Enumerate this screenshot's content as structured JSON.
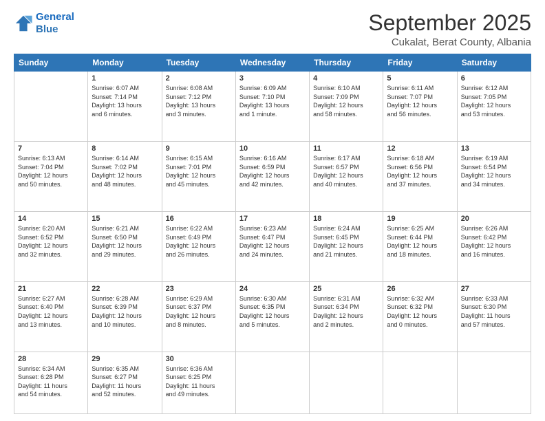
{
  "header": {
    "logo_line1": "General",
    "logo_line2": "Blue",
    "month": "September 2025",
    "location": "Cukalat, Berat County, Albania"
  },
  "weekdays": [
    "Sunday",
    "Monday",
    "Tuesday",
    "Wednesday",
    "Thursday",
    "Friday",
    "Saturday"
  ],
  "weeks": [
    [
      {
        "day": "",
        "info": ""
      },
      {
        "day": "1",
        "info": "Sunrise: 6:07 AM\nSunset: 7:14 PM\nDaylight: 13 hours\nand 6 minutes."
      },
      {
        "day": "2",
        "info": "Sunrise: 6:08 AM\nSunset: 7:12 PM\nDaylight: 13 hours\nand 3 minutes."
      },
      {
        "day": "3",
        "info": "Sunrise: 6:09 AM\nSunset: 7:10 PM\nDaylight: 13 hours\nand 1 minute."
      },
      {
        "day": "4",
        "info": "Sunrise: 6:10 AM\nSunset: 7:09 PM\nDaylight: 12 hours\nand 58 minutes."
      },
      {
        "day": "5",
        "info": "Sunrise: 6:11 AM\nSunset: 7:07 PM\nDaylight: 12 hours\nand 56 minutes."
      },
      {
        "day": "6",
        "info": "Sunrise: 6:12 AM\nSunset: 7:05 PM\nDaylight: 12 hours\nand 53 minutes."
      }
    ],
    [
      {
        "day": "7",
        "info": "Sunrise: 6:13 AM\nSunset: 7:04 PM\nDaylight: 12 hours\nand 50 minutes."
      },
      {
        "day": "8",
        "info": "Sunrise: 6:14 AM\nSunset: 7:02 PM\nDaylight: 12 hours\nand 48 minutes."
      },
      {
        "day": "9",
        "info": "Sunrise: 6:15 AM\nSunset: 7:01 PM\nDaylight: 12 hours\nand 45 minutes."
      },
      {
        "day": "10",
        "info": "Sunrise: 6:16 AM\nSunset: 6:59 PM\nDaylight: 12 hours\nand 42 minutes."
      },
      {
        "day": "11",
        "info": "Sunrise: 6:17 AM\nSunset: 6:57 PM\nDaylight: 12 hours\nand 40 minutes."
      },
      {
        "day": "12",
        "info": "Sunrise: 6:18 AM\nSunset: 6:56 PM\nDaylight: 12 hours\nand 37 minutes."
      },
      {
        "day": "13",
        "info": "Sunrise: 6:19 AM\nSunset: 6:54 PM\nDaylight: 12 hours\nand 34 minutes."
      }
    ],
    [
      {
        "day": "14",
        "info": "Sunrise: 6:20 AM\nSunset: 6:52 PM\nDaylight: 12 hours\nand 32 minutes."
      },
      {
        "day": "15",
        "info": "Sunrise: 6:21 AM\nSunset: 6:50 PM\nDaylight: 12 hours\nand 29 minutes."
      },
      {
        "day": "16",
        "info": "Sunrise: 6:22 AM\nSunset: 6:49 PM\nDaylight: 12 hours\nand 26 minutes."
      },
      {
        "day": "17",
        "info": "Sunrise: 6:23 AM\nSunset: 6:47 PM\nDaylight: 12 hours\nand 24 minutes."
      },
      {
        "day": "18",
        "info": "Sunrise: 6:24 AM\nSunset: 6:45 PM\nDaylight: 12 hours\nand 21 minutes."
      },
      {
        "day": "19",
        "info": "Sunrise: 6:25 AM\nSunset: 6:44 PM\nDaylight: 12 hours\nand 18 minutes."
      },
      {
        "day": "20",
        "info": "Sunrise: 6:26 AM\nSunset: 6:42 PM\nDaylight: 12 hours\nand 16 minutes."
      }
    ],
    [
      {
        "day": "21",
        "info": "Sunrise: 6:27 AM\nSunset: 6:40 PM\nDaylight: 12 hours\nand 13 minutes."
      },
      {
        "day": "22",
        "info": "Sunrise: 6:28 AM\nSunset: 6:39 PM\nDaylight: 12 hours\nand 10 minutes."
      },
      {
        "day": "23",
        "info": "Sunrise: 6:29 AM\nSunset: 6:37 PM\nDaylight: 12 hours\nand 8 minutes."
      },
      {
        "day": "24",
        "info": "Sunrise: 6:30 AM\nSunset: 6:35 PM\nDaylight: 12 hours\nand 5 minutes."
      },
      {
        "day": "25",
        "info": "Sunrise: 6:31 AM\nSunset: 6:34 PM\nDaylight: 12 hours\nand 2 minutes."
      },
      {
        "day": "26",
        "info": "Sunrise: 6:32 AM\nSunset: 6:32 PM\nDaylight: 12 hours\nand 0 minutes."
      },
      {
        "day": "27",
        "info": "Sunrise: 6:33 AM\nSunset: 6:30 PM\nDaylight: 11 hours\nand 57 minutes."
      }
    ],
    [
      {
        "day": "28",
        "info": "Sunrise: 6:34 AM\nSunset: 6:28 PM\nDaylight: 11 hours\nand 54 minutes."
      },
      {
        "day": "29",
        "info": "Sunrise: 6:35 AM\nSunset: 6:27 PM\nDaylight: 11 hours\nand 52 minutes."
      },
      {
        "day": "30",
        "info": "Sunrise: 6:36 AM\nSunset: 6:25 PM\nDaylight: 11 hours\nand 49 minutes."
      },
      {
        "day": "",
        "info": ""
      },
      {
        "day": "",
        "info": ""
      },
      {
        "day": "",
        "info": ""
      },
      {
        "day": "",
        "info": ""
      }
    ]
  ]
}
